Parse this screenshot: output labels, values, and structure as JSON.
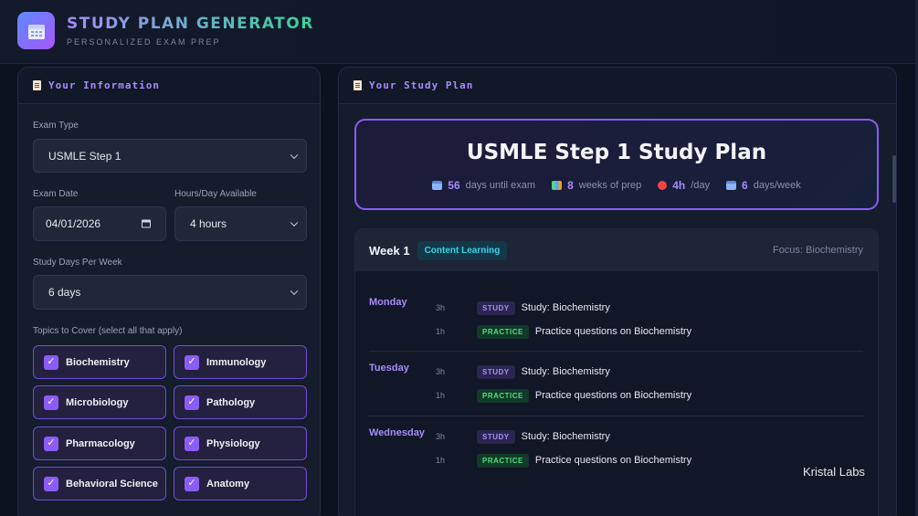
{
  "app": {
    "title": "STUDY PLAN GENERATOR",
    "subtitle": "PERSONALIZED EXAM PREP"
  },
  "info_panel": {
    "title": "Your Information",
    "exam_type_label": "Exam Type",
    "exam_type_value": "USMLE Step 1",
    "exam_date_label": "Exam Date",
    "exam_date_value": "04/01/2026",
    "hours_label": "Hours/Day Available",
    "hours_value": "4 hours",
    "days_label": "Study Days Per Week",
    "days_value": "6 days",
    "topics_label": "Topics to Cover (select all that apply)",
    "topics": [
      {
        "label": "Biochemistry",
        "checked": true
      },
      {
        "label": "Immunology",
        "checked": true
      },
      {
        "label": "Microbiology",
        "checked": true
      },
      {
        "label": "Pathology",
        "checked": true
      },
      {
        "label": "Pharmacology",
        "checked": true
      },
      {
        "label": "Physiology",
        "checked": true
      },
      {
        "label": "Behavioral Science",
        "checked": true
      },
      {
        "label": "Anatomy",
        "checked": true
      }
    ],
    "check_glyph": "✓"
  },
  "plan_panel": {
    "title": "Your Study Plan",
    "hero_title": "USMLE Step 1 Study Plan",
    "stats": [
      {
        "icon": "calendar-icon",
        "value": "56",
        "label": "days until exam"
      },
      {
        "icon": "books-icon",
        "value": "8",
        "label": "weeks of prep"
      },
      {
        "icon": "alarm-clock-icon",
        "value": "4h",
        "label": "/day"
      },
      {
        "icon": "calendar-icon",
        "value": "6",
        "label": "days/week"
      }
    ],
    "week": {
      "title": "Week 1",
      "badge": "Content Learning",
      "focus": "Focus: Biochemistry",
      "days": [
        {
          "name": "Monday",
          "tasks": [
            {
              "duration": "3h",
              "tag": "STUDY",
              "text": "Study: Biochemistry"
            },
            {
              "duration": "1h",
              "tag": "PRACTICE",
              "text": "Practice questions on Biochemistry"
            }
          ]
        },
        {
          "name": "Tuesday",
          "tasks": [
            {
              "duration": "3h",
              "tag": "STUDY",
              "text": "Study: Biochemistry"
            },
            {
              "duration": "1h",
              "tag": "PRACTICE",
              "text": "Practice questions on Biochemistry"
            }
          ]
        },
        {
          "name": "Wednesday",
          "tasks": [
            {
              "duration": "3h",
              "tag": "STUDY",
              "text": "Study: Biochemistry"
            },
            {
              "duration": "1h",
              "tag": "PRACTICE",
              "text": "Practice questions on Biochemistry"
            }
          ]
        }
      ]
    }
  },
  "watermark": "Kristal Labs",
  "colors": {
    "accent": "#8b5cf6",
    "background": "#0d1220",
    "panel": "#151c2c",
    "study_tag": "#a78bfa",
    "practice_tag": "#4ade80",
    "badge": "#38d5e8"
  }
}
